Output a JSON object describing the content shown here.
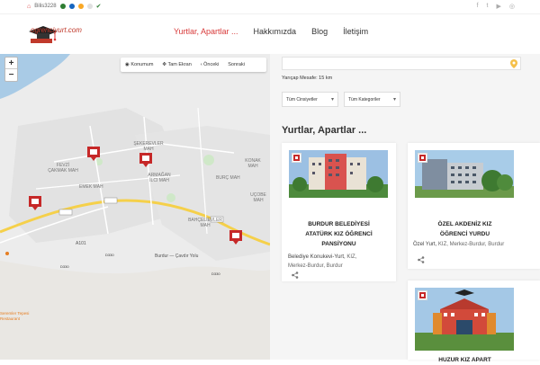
{
  "topbar": {
    "phone": "Bilis3228",
    "social_icons": [
      "facebook-icon",
      "twitter-icon",
      "youtube-icon",
      "instagram-icon"
    ]
  },
  "header": {
    "logo_text": "ogrenciyurt.com",
    "nav": [
      {
        "label": "Yurtlar, Apartlar ..."
      },
      {
        "label": "Hakkımızda"
      },
      {
        "label": "Blog"
      },
      {
        "label": "İletişim"
      }
    ]
  },
  "map": {
    "zoom_in": "+",
    "zoom_out": "−",
    "buttons": [
      "Konumum",
      "Tam Ekran",
      "Önceki",
      "Sonraki"
    ],
    "labels": {
      "sekerevler": "ŞEKEREVLER MAH",
      "fevzi": "FEVZİ ÇAKMAK MAH",
      "emek": "EMEK MAH",
      "armagan": "ARMAĞAN İLCI MAH",
      "konak": "KONAK MAH",
      "burc": "BURÇ MAH",
      "bahcelievler": "BAHÇELİEVLER MAH",
      "ucoba": "UÇOBE MAH",
      "road1": "Burdur — Çavdır Yolu",
      "a101": "A101",
      "d330_1": "D330",
      "d330_2": "D330",
      "d330_3": "D330",
      "restaurant": "Seremler Tepesi Restaurant"
    }
  },
  "filters": {
    "search_placeholder": "",
    "radius": "Yarıçap Mesafe: 15 km",
    "gender": "Tüm Cinsiyetler",
    "category": "Tüm Kategoriler",
    "caret": "▾"
  },
  "section_title": "Yurtlar, Apartlar ...",
  "cards": [
    {
      "title_lines": [
        "BURDUR BELEDİYESİ",
        "ATATÜRK KIZ ÖĞRENCİ",
        "PANSİYONU"
      ],
      "meta_line1_prefix": "Belediye Konukevi-Yurt,",
      "meta_line1_link": " KIZ,",
      "meta_line2": "Merkez-Burdur, Burdur"
    },
    {
      "title_lines": [
        "ÖZEL AKDENİZ KIZ",
        "ÖĞRENCİ YURDU"
      ],
      "meta_line1_prefix": "Özel Yurt,",
      "meta_line1_link": " KIZ, Merkez-Burdur, Burdur"
    },
    {
      "title_lines": [
        "HUZUR KIZ APART"
      ]
    }
  ],
  "colors": {
    "accent": "#d83a3a",
    "map_bg": "#ececec",
    "water": "#a9cbe6",
    "road_yellow": "#f5d04a",
    "marker_red": "#c62828"
  }
}
